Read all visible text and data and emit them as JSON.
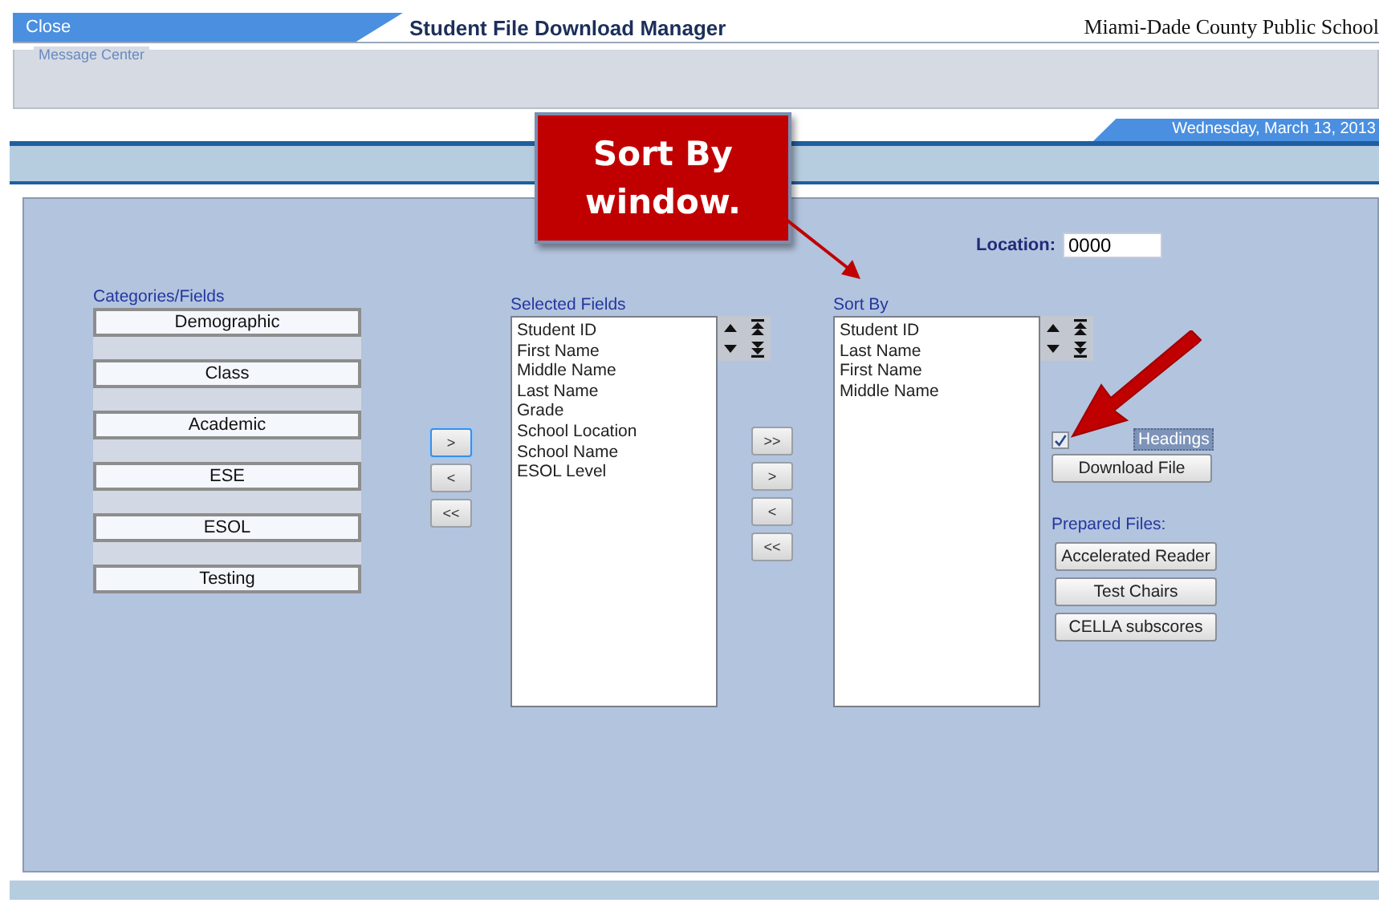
{
  "top_bar": {
    "close": "Close",
    "title": "Student File Download Manager",
    "district": "Miami-Dade County Public School"
  },
  "message_center": {
    "label": "Message Center"
  },
  "date": "Wednesday, March 13, 2013",
  "location": {
    "label": "Location:",
    "value": "0000"
  },
  "categories": {
    "label": "Categories/Fields",
    "items": [
      "Demographic",
      "Class",
      "Academic",
      "ESE",
      "ESOL",
      "Testing"
    ]
  },
  "category_move_buttons": [
    {
      "label": ">",
      "focused": true
    },
    {
      "label": "<",
      "focused": false
    },
    {
      "label": "<<",
      "focused": false
    }
  ],
  "selected_fields": {
    "label": "Selected Fields",
    "items": [
      "Student ID",
      "First Name",
      "Middle Name",
      "Last Name",
      "Grade",
      "School Location",
      "School Name",
      "ESOL Level"
    ]
  },
  "field_move_buttons": [
    {
      "label": ">>",
      "focused": false
    },
    {
      "label": ">",
      "focused": false
    },
    {
      "label": "<",
      "focused": false
    },
    {
      "label": "<<",
      "focused": false
    }
  ],
  "sort_by": {
    "label": "Sort By",
    "items": [
      "Student ID",
      "Last Name",
      "First Name",
      "Middle Name"
    ]
  },
  "headings_checkbox": {
    "label": "Headings",
    "checked": true
  },
  "download_button": "Download File",
  "prepared_files": {
    "label": "Prepared Files:",
    "buttons": [
      "Accelerated Reader",
      "Test Chairs",
      "CELLA subscores"
    ]
  },
  "callout": {
    "text": "Sort By window."
  }
}
